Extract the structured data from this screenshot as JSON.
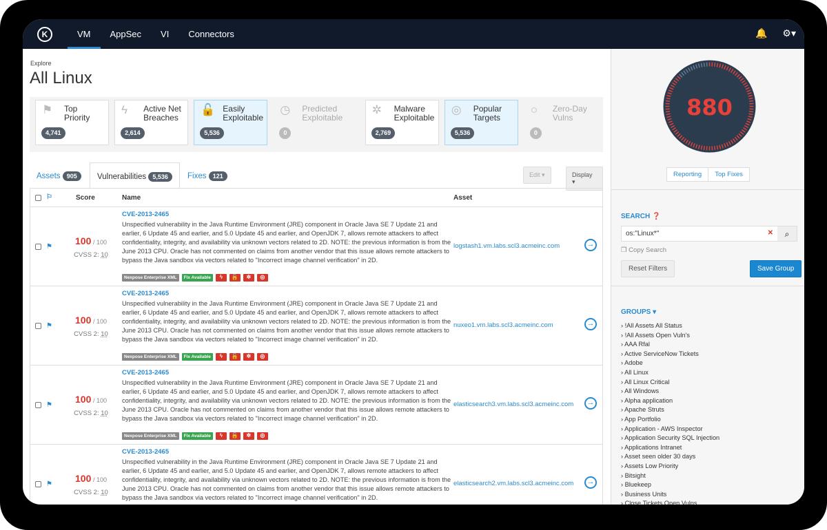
{
  "nav": {
    "logo": "K",
    "items": [
      "VM",
      "AppSec",
      "VI",
      "Connectors"
    ],
    "active": 0,
    "bell_icon": "bell-icon",
    "gear_icon": "gear-icon"
  },
  "page": {
    "breadcrumb": "Explore",
    "title": "All Linux"
  },
  "cards": [
    {
      "label1": "Top",
      "label2": "Priority",
      "count": "4,741",
      "icon": "⚑",
      "state": "normal"
    },
    {
      "label1": "Active Net",
      "label2": "Breaches",
      "count": "2,614",
      "icon": "ϟ",
      "state": "normal"
    },
    {
      "label1": "Easily",
      "label2": "Exploitable",
      "count": "5,536",
      "icon": "🔓",
      "state": "sel"
    },
    {
      "label1": "Predicted",
      "label2": "Exploitable",
      "count": "0",
      "icon": "◷",
      "state": "dis"
    },
    {
      "label1": "Malware",
      "label2": "Exploitable",
      "count": "2,769",
      "icon": "✲",
      "state": "normal"
    },
    {
      "label1": "Popular",
      "label2": "Targets",
      "count": "5,536",
      "icon": "◎",
      "state": "sel"
    },
    {
      "label1": "Zero-Day",
      "label2": "Vulns",
      "count": "0",
      "icon": "○",
      "state": "dis"
    }
  ],
  "tabs": {
    "assets": "Assets",
    "assets_count": "905",
    "vulns": "Vulnerabilities",
    "vulns_count": "5,536",
    "fixes": "Fixes",
    "fixes_count": "121",
    "edit": "Edit ▾",
    "display": "Display ▾"
  },
  "table": {
    "headers": {
      "score": "Score",
      "name": "Name",
      "asset": "Asset"
    },
    "rows": [
      {
        "score": "100",
        "max": "/ 100",
        "cvss_label": "CVSS 2:",
        "cvss": "10",
        "cve": "CVE-2013-2465",
        "asset": "logstash1.vm.labs.scl3.acmeinc.com"
      },
      {
        "score": "100",
        "max": "/ 100",
        "cvss_label": "CVSS 2:",
        "cvss": "10",
        "cve": "CVE-2013-2465",
        "asset": "nuxeo1.vm.labs.scl3.acmeinc.com"
      },
      {
        "score": "100",
        "max": "/ 100",
        "cvss_label": "CVSS 2:",
        "cvss": "10",
        "cve": "CVE-2013-2465",
        "asset": "elasticsearch3.vm.labs.scl3.acmeinc.com"
      },
      {
        "score": "100",
        "max": "/ 100",
        "cvss_label": "CVSS 2:",
        "cvss": "10",
        "cve": "CVE-2013-2465",
        "asset": "elasticsearch2.vm.labs.scl3.acmeinc.com"
      }
    ],
    "description": "Unspecified vulnerability in the Java Runtime Environment (JRE) component in Oracle Java SE 7 Update 21 and earlier, 6 Update 45 and earlier, and 5.0 Update 45 and earlier, and OpenJDK 7, allows remote attackers to affect confidentiality, integrity, and availability via unknown vectors related to 2D. NOTE: the previous information is from the June 2013 CPU. Oracle has not commented on claims from another vendor that this issue allows remote attackers to bypass the Java sandbox via vectors related to \"Incorrect image channel verification\" in 2D.",
    "tag_source": "Nexpose Enterprise XML",
    "tag_fix": "Fix Available"
  },
  "side": {
    "risk_score": "880",
    "risk_fraction": 0.88,
    "reporting": "Reporting",
    "top_fixes": "Top Fixes",
    "search_title": "SEARCH",
    "search_value": "os:\"Linux*\"",
    "copy_search": "Copy Search",
    "reset": "Reset Filters",
    "save": "Save Group",
    "groups_title": "GROUPS ▾",
    "groups": [
      "!All Assets All Status",
      "!All Assets Open Vuln's",
      "AAA Rfal",
      "Active ServiceNow Tickets",
      "Adobe",
      "All Linux",
      "All Linux Critical",
      "All Windows",
      "Alpha application",
      "Apache Struts",
      "App Portfolio",
      "Application - AWS Inspector",
      "Application Security SQL Injection",
      "Applications Intranet",
      "Asset seen older 30 days",
      "Assets Low Priority",
      "Bitsight",
      "Bluekeep",
      "Business Units",
      "Close Tickets Open Vulns"
    ]
  },
  "colors": {
    "nav": "#111a2a",
    "accent": "#2a8ad0",
    "danger": "#d9352b",
    "success": "#3aa551",
    "gauge": "#2b3c4e"
  }
}
